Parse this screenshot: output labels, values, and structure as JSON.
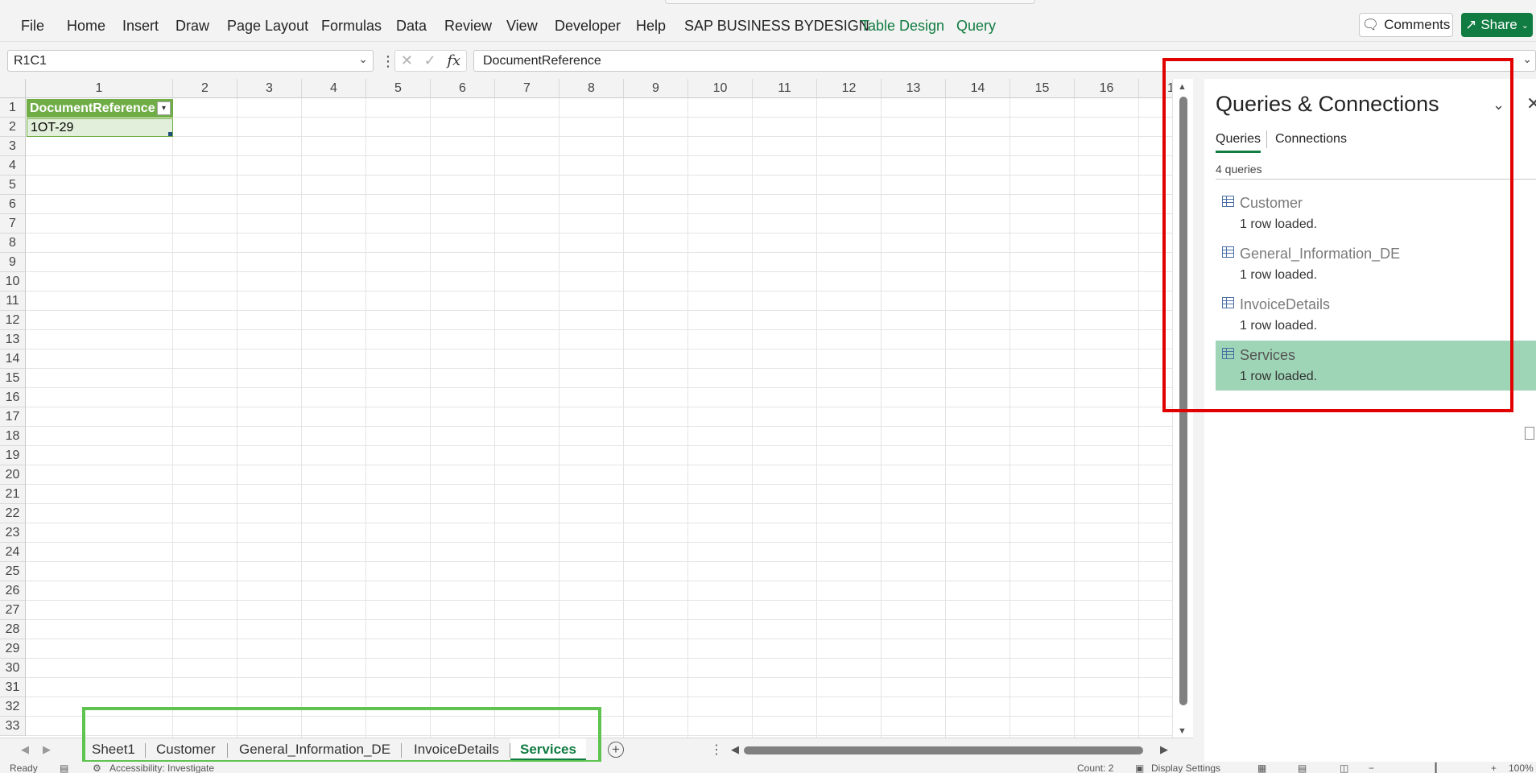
{
  "ribbon": {
    "tabs": [
      "File",
      "Home",
      "Insert",
      "Draw",
      "Page Layout",
      "Formulas",
      "Data",
      "Review",
      "View",
      "Developer",
      "Help",
      "SAP BUSINESS BYDESIGN",
      "Table Design",
      "Query"
    ],
    "comments_label": "Comments",
    "share_label": "Share"
  },
  "formula_bar": {
    "name_box": "R1C1",
    "formula": "DocumentReference",
    "fx_label": "fx"
  },
  "grid": {
    "columns": [
      "1",
      "2",
      "3",
      "4",
      "5",
      "6",
      "7",
      "8",
      "9",
      "10",
      "11",
      "12",
      "13",
      "14",
      "15",
      "16",
      "1"
    ],
    "rows": [
      "1",
      "2",
      "3",
      "4",
      "5",
      "6",
      "7",
      "8",
      "9",
      "10",
      "11",
      "12",
      "13",
      "14",
      "15",
      "16",
      "17",
      "18",
      "19",
      "20",
      "21",
      "22",
      "23",
      "24",
      "25",
      "26",
      "27",
      "28",
      "29",
      "30",
      "31",
      "32",
      "33"
    ],
    "table_header": "DocumentReference",
    "table_value": "1OT-29"
  },
  "sheets": {
    "tabs": [
      "Sheet1",
      "Customer",
      "General_Information_DE",
      "InvoiceDetails",
      "Services"
    ],
    "active": "Services"
  },
  "statusbar": {
    "ready": "Ready",
    "accessibility": "Accessibility: Investigate",
    "count": "Count: 2",
    "display_settings": "Display Settings",
    "zoom": "100%"
  },
  "queries_pane": {
    "title": "Queries & Connections",
    "tab_queries": "Queries",
    "tab_connections": "Connections",
    "count_text": "4 queries",
    "items": [
      {
        "name": "Customer",
        "status": "1 row loaded."
      },
      {
        "name": "General_Information_DE",
        "status": "1 row loaded."
      },
      {
        "name": "InvoiceDetails",
        "status": "1 row loaded."
      },
      {
        "name": "Services",
        "status": "1 row loaded."
      }
    ]
  },
  "colors": {
    "excel_green": "#107c41",
    "table_header": "#70ad47",
    "selected_query": "#9fd5b7",
    "red_highlight": "#e00000",
    "green_highlight": "#5ec44f"
  }
}
